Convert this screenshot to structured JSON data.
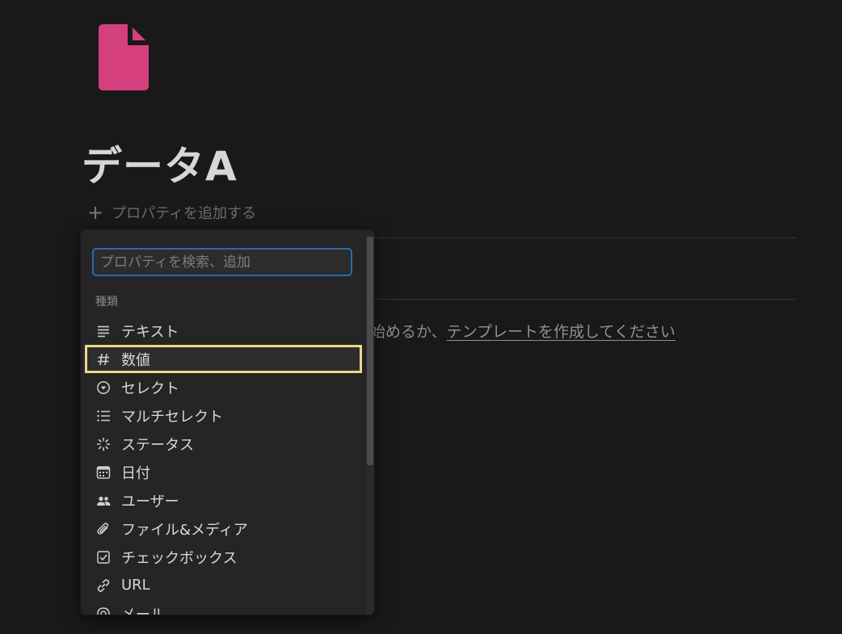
{
  "page": {
    "icon": "document-icon",
    "title": "データA",
    "add_property_label": "プロパティを追加する",
    "empty_text": "始めるか、",
    "template_link": "テンプレートを作成してください"
  },
  "menu": {
    "search_placeholder": "プロパティを検索、追加",
    "search_value": "",
    "section_label": "種類",
    "types": [
      {
        "label": "テキスト",
        "icon": "text-lines-icon"
      },
      {
        "label": "数値",
        "icon": "hash-icon",
        "selected": true
      },
      {
        "label": "セレクト",
        "icon": "select-circle-icon"
      },
      {
        "label": "マルチセレクト",
        "icon": "list-icon"
      },
      {
        "label": "ステータス",
        "icon": "status-spinner-icon"
      },
      {
        "label": "日付",
        "icon": "calendar-icon"
      },
      {
        "label": "ユーザー",
        "icon": "people-icon"
      },
      {
        "label": "ファイル&メディア",
        "icon": "paperclip-icon"
      },
      {
        "label": "チェックボックス",
        "icon": "checkbox-icon"
      },
      {
        "label": "URL",
        "icon": "link-icon"
      },
      {
        "label": "メール",
        "icon": "at-icon"
      }
    ]
  },
  "colors": {
    "background": "#191919",
    "menu_background": "#252525",
    "page_icon": "#d63f7e",
    "focus_ring": "#2a6bb0",
    "highlight": "#f0d688"
  }
}
